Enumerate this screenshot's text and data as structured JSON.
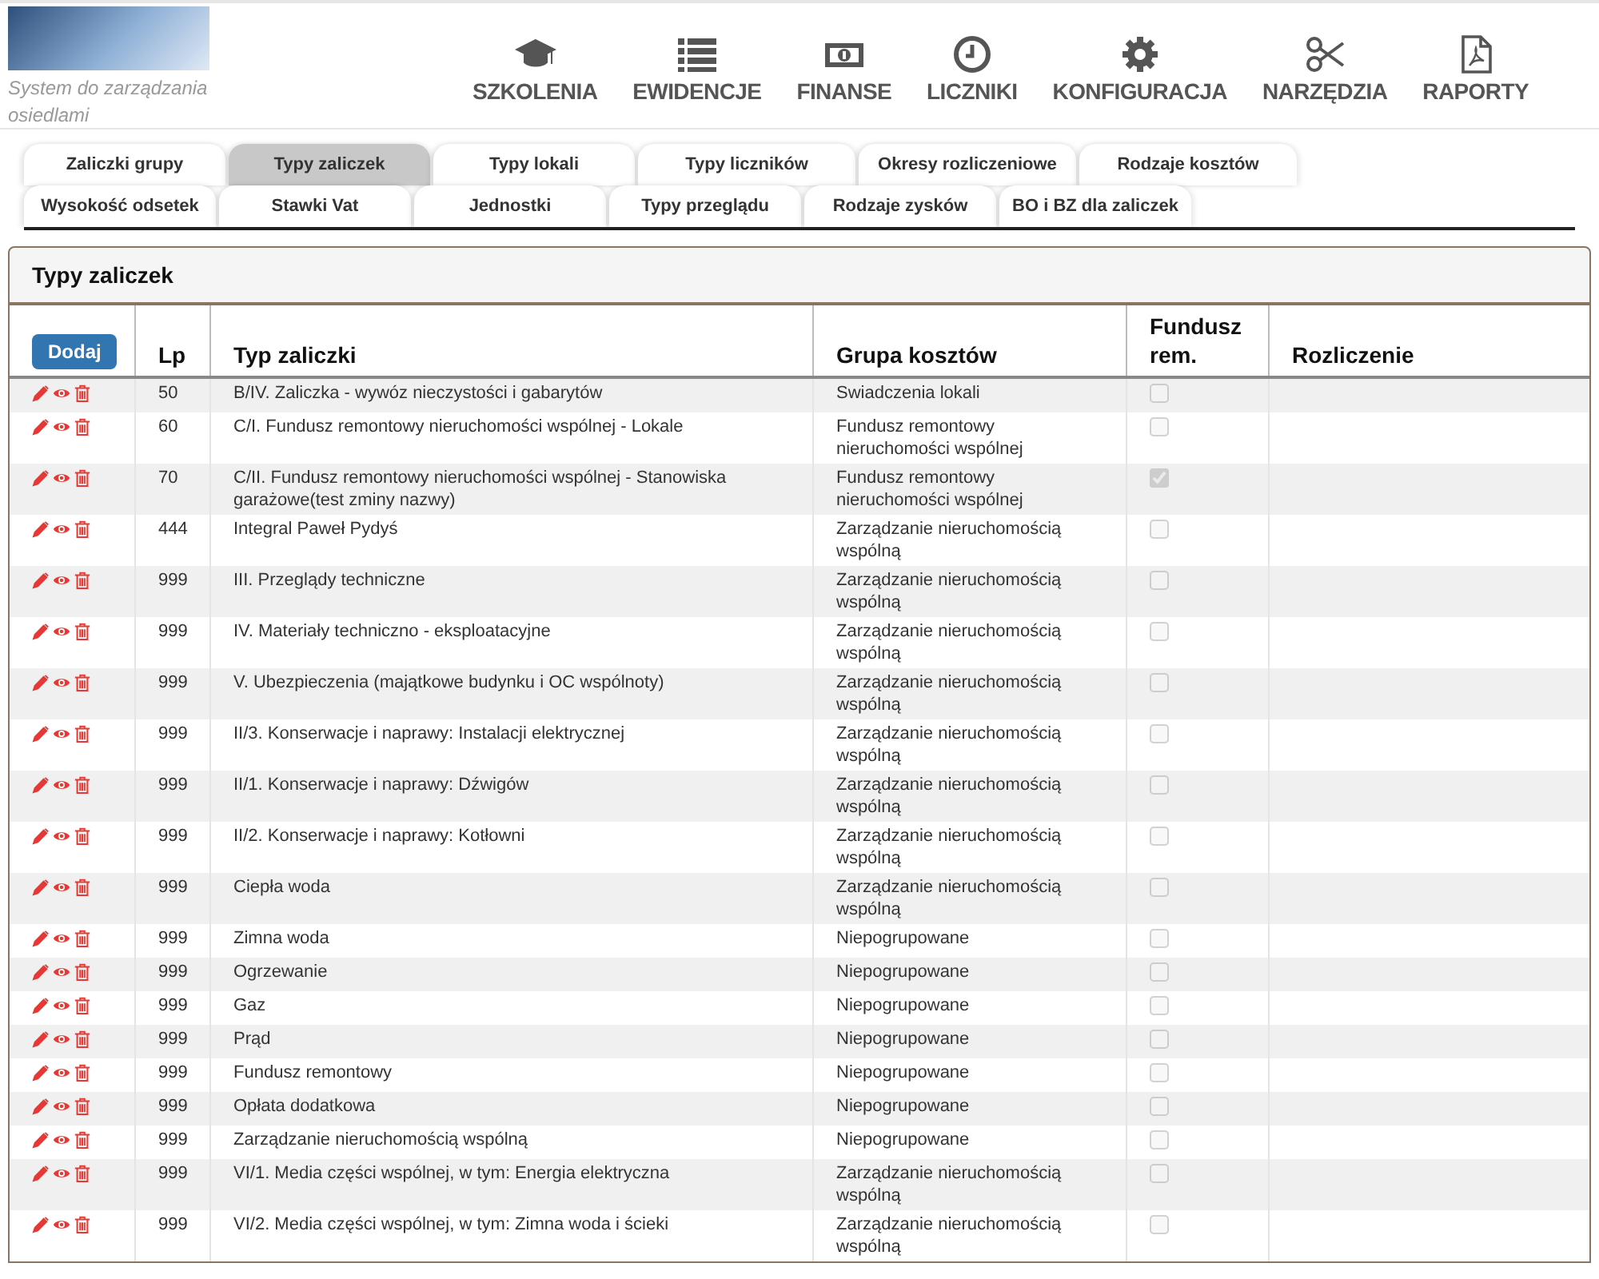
{
  "header": {
    "tagline": "System do zarządzania osiedlami",
    "nav": [
      {
        "label": "SZKOLENIA"
      },
      {
        "label": "EWIDENCJE"
      },
      {
        "label": "FINANSE"
      },
      {
        "label": "LICZNIKI"
      },
      {
        "label": "KONFIGURACJA"
      },
      {
        "label": "NARZĘDZIA"
      },
      {
        "label": "RAPORTY"
      }
    ]
  },
  "tab_rows": [
    [
      {
        "label": "Zaliczki grupy",
        "selected": false
      },
      {
        "label": "Typy zaliczek",
        "selected": true
      },
      {
        "label": "Typy lokali",
        "selected": false
      },
      {
        "label": "Typy liczników",
        "selected": false
      },
      {
        "label": "Okresy rozliczeniowe",
        "selected": false
      },
      {
        "label": "Rodzaje kosztów",
        "selected": false
      }
    ],
    [
      {
        "label": "Wysokość odsetek",
        "selected": false
      },
      {
        "label": "Stawki Vat",
        "selected": false
      },
      {
        "label": "Jednostki",
        "selected": false
      },
      {
        "label": "Typy przeglądu",
        "selected": false
      },
      {
        "label": "Rodzaje zysków",
        "selected": false
      },
      {
        "label": "BO i BZ dla zaliczek",
        "selected": false
      }
    ]
  ],
  "panel": {
    "title": "Typy zaliczek",
    "add_button": "Dodaj",
    "columns": [
      "Lp",
      "Typ zaliczki",
      "Grupa kosztów",
      "Fundusz rem.",
      "Rozliczenie"
    ],
    "rows": [
      {
        "lp": "50",
        "typ": "B/IV. Zaliczka - wywóz nieczystości i gabarytów",
        "grupa": "Swiadczenia lokali",
        "fundusz_rem": false
      },
      {
        "lp": "60",
        "typ": "C/I. Fundusz remontowy nieruchomości wspólnej - Lokale",
        "grupa": "Fundusz remontowy nieruchomości wspólnej",
        "fundusz_rem": false
      },
      {
        "lp": "70",
        "typ": "C/II. Fundusz remontowy nieruchomości wspólnej - Stanowiska garażowe(test zminy nazwy)",
        "grupa": "Fundusz remontowy nieruchomości wspólnej",
        "fundusz_rem": true
      },
      {
        "lp": "444",
        "typ": "Integral Paweł Pydyś",
        "grupa": "Zarządzanie nieruchomością wspólną",
        "fundusz_rem": false
      },
      {
        "lp": "999",
        "typ": "III. Przeglądy techniczne",
        "grupa": "Zarządzanie nieruchomością wspólną",
        "fundusz_rem": false
      },
      {
        "lp": "999",
        "typ": "IV. Materiały techniczno - eksploatacyjne",
        "grupa": "Zarządzanie nieruchomością wspólną",
        "fundusz_rem": false
      },
      {
        "lp": "999",
        "typ": "V. Ubezpieczenia (majątkowe budynku i OC wspólnoty)",
        "grupa": "Zarządzanie nieruchomością wspólną",
        "fundusz_rem": false
      },
      {
        "lp": "999",
        "typ": "II/3. Konserwacje i naprawy: Instalacji elektrycznej",
        "grupa": "Zarządzanie nieruchomością wspólną",
        "fundusz_rem": false
      },
      {
        "lp": "999",
        "typ": "II/1. Konserwacje i naprawy: Dźwigów",
        "grupa": "Zarządzanie nieruchomością wspólną",
        "fundusz_rem": false
      },
      {
        "lp": "999",
        "typ": "II/2. Konserwacje i naprawy: Kotłowni",
        "grupa": "Zarządzanie nieruchomością wspólną",
        "fundusz_rem": false
      },
      {
        "lp": "999",
        "typ": "Ciepła woda",
        "grupa": "Zarządzanie nieruchomością wspólną",
        "fundusz_rem": false
      },
      {
        "lp": "999",
        "typ": "Zimna woda",
        "grupa": "Niepogrupowane",
        "fundusz_rem": false
      },
      {
        "lp": "999",
        "typ": "Ogrzewanie",
        "grupa": "Niepogrupowane",
        "fundusz_rem": false
      },
      {
        "lp": "999",
        "typ": "Gaz",
        "grupa": "Niepogrupowane",
        "fundusz_rem": false
      },
      {
        "lp": "999",
        "typ": "Prąd",
        "grupa": "Niepogrupowane",
        "fundusz_rem": false
      },
      {
        "lp": "999",
        "typ": "Fundusz remontowy",
        "grupa": "Niepogrupowane",
        "fundusz_rem": false
      },
      {
        "lp": "999",
        "typ": "Opłata dodatkowa",
        "grupa": "Niepogrupowane",
        "fundusz_rem": false
      },
      {
        "lp": "999",
        "typ": "Zarządzanie nieruchomością wspólną",
        "grupa": "Niepogrupowane",
        "fundusz_rem": false
      },
      {
        "lp": "999",
        "typ": "VI/1. Media części wspólnej, w tym: Energia elektryczna",
        "grupa": "Zarządzanie nieruchomością wspólną",
        "fundusz_rem": false
      },
      {
        "lp": "999",
        "typ": "VI/2. Media części wspólnej, w tym: Zimna woda i ścieki",
        "grupa": "Zarządzanie nieruchomością wspólną",
        "fundusz_rem": false
      }
    ]
  }
}
